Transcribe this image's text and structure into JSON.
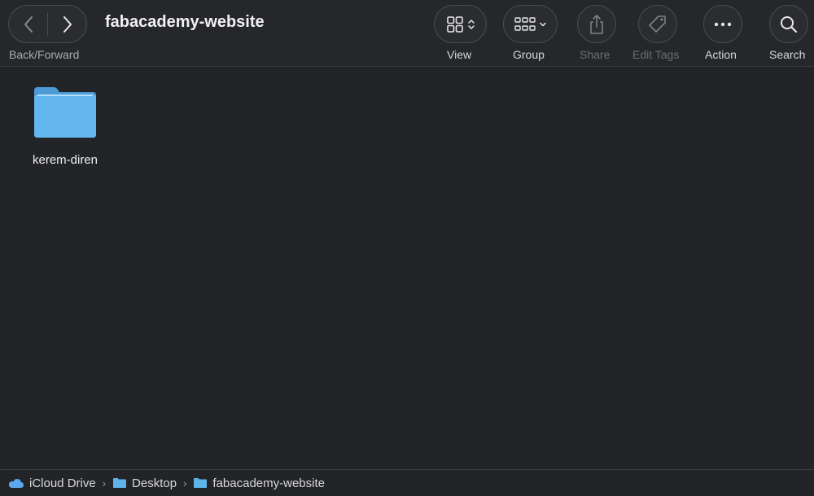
{
  "toolbar": {
    "back_forward_label": "Back/Forward",
    "title": "fabacademy-website",
    "view_label": "View",
    "group_label": "Group",
    "share_label": "Share",
    "edit_tags_label": "Edit Tags",
    "action_label": "Action",
    "search_label": "Search"
  },
  "content": {
    "items": [
      {
        "name": "kerem-diren",
        "icon": "folder-icon"
      }
    ]
  },
  "pathbar": {
    "crumbs": [
      {
        "label": "iCloud Drive",
        "icon": "icloud-icon"
      },
      {
        "label": "Desktop",
        "icon": "folder-icon"
      },
      {
        "label": "fabacademy-website",
        "icon": "folder-icon"
      }
    ]
  },
  "colors": {
    "background": "#222427",
    "folder": "#5eb3ea",
    "icloud": "#5aa9ee"
  }
}
